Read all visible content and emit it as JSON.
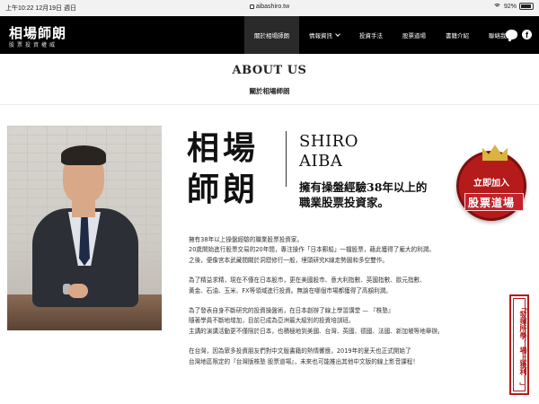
{
  "statusbar": {
    "time": "上午10:22  12月19日 週日",
    "url": "aibashiro.tw",
    "battery": "92%",
    "battery_level": 0.92
  },
  "header": {
    "logo_title": "相場師朗",
    "logo_subtitle": "股票投資權威",
    "nav": [
      {
        "label": "關於相場師朗",
        "active": true
      },
      {
        "label": "情報資訊",
        "dropdown": true
      },
      {
        "label": "投資手法"
      },
      {
        "label": "股票道場"
      },
      {
        "label": "書籍介紹"
      },
      {
        "label": "聯絡我們"
      }
    ]
  },
  "about": {
    "title": "ABOUT US",
    "subtitle": "關於相場師朗"
  },
  "profile": {
    "jp_name_line1": "相場",
    "jp_name_line2": "師朗",
    "en_name_line1": "SHIRO",
    "en_name_line2": "AIBA",
    "tagline_line1": "擁有操盤經驗38年以上的",
    "tagline_line2": "職業股票投資家。"
  },
  "badge": {
    "line1": "立即加入",
    "line2": "股票道場"
  },
  "banner": {
    "text": "「發揮所學，場上獲利！」"
  },
  "paragraphs": [
    [
      "擁有38年以上操盤經驗的職業股票投資家。",
      "20歲開始進行股票交易的20年間，專注操作「日本郵船」一檔股票，藉此獲得了龐大的利潤。",
      "之後，便像宮本武藏間關於洞窟修行一般，埋頭研究K線走勢圖和多空雙作。"
    ],
    [
      "為了精益求精，現在不僅在日本股市，更在美國股市、意大利指數、英國指數、歐元指數、",
      "黃金、石油、玉米、FX等領域進行投資。無論在哪個市場都獲得了高額利潤。"
    ],
    [
      "為了發表自身不斷研究的投資操盤術，在日本創辦了線上學習講堂 — 『株塾』",
      "隨著學員不斷地增加，目前已成為亞洲最大級別的投資培訓班。",
      "主講的演講活動更不僅限於日本，也積極地到美國、台灣、英國、德國、法國、新加坡等地舉辦。"
    ],
    [
      "在台灣，因為眾多投資朋友們對中文版書籍的熱情響應，2019年的夏天也正式開始了",
      "台灣地區限定的『台灣版株塾 股票道場』，未來也可能推出其他中文版的線上影音課程！"
    ]
  ],
  "icons": {
    "line": "line-icon",
    "facebook": "facebook-icon",
    "wifi": "wifi-icon",
    "battery": "battery-icon",
    "lock": "lock-icon"
  },
  "colors": {
    "header_bg": "#000000",
    "accent_red": "#b51b1b",
    "text": "#222222"
  }
}
